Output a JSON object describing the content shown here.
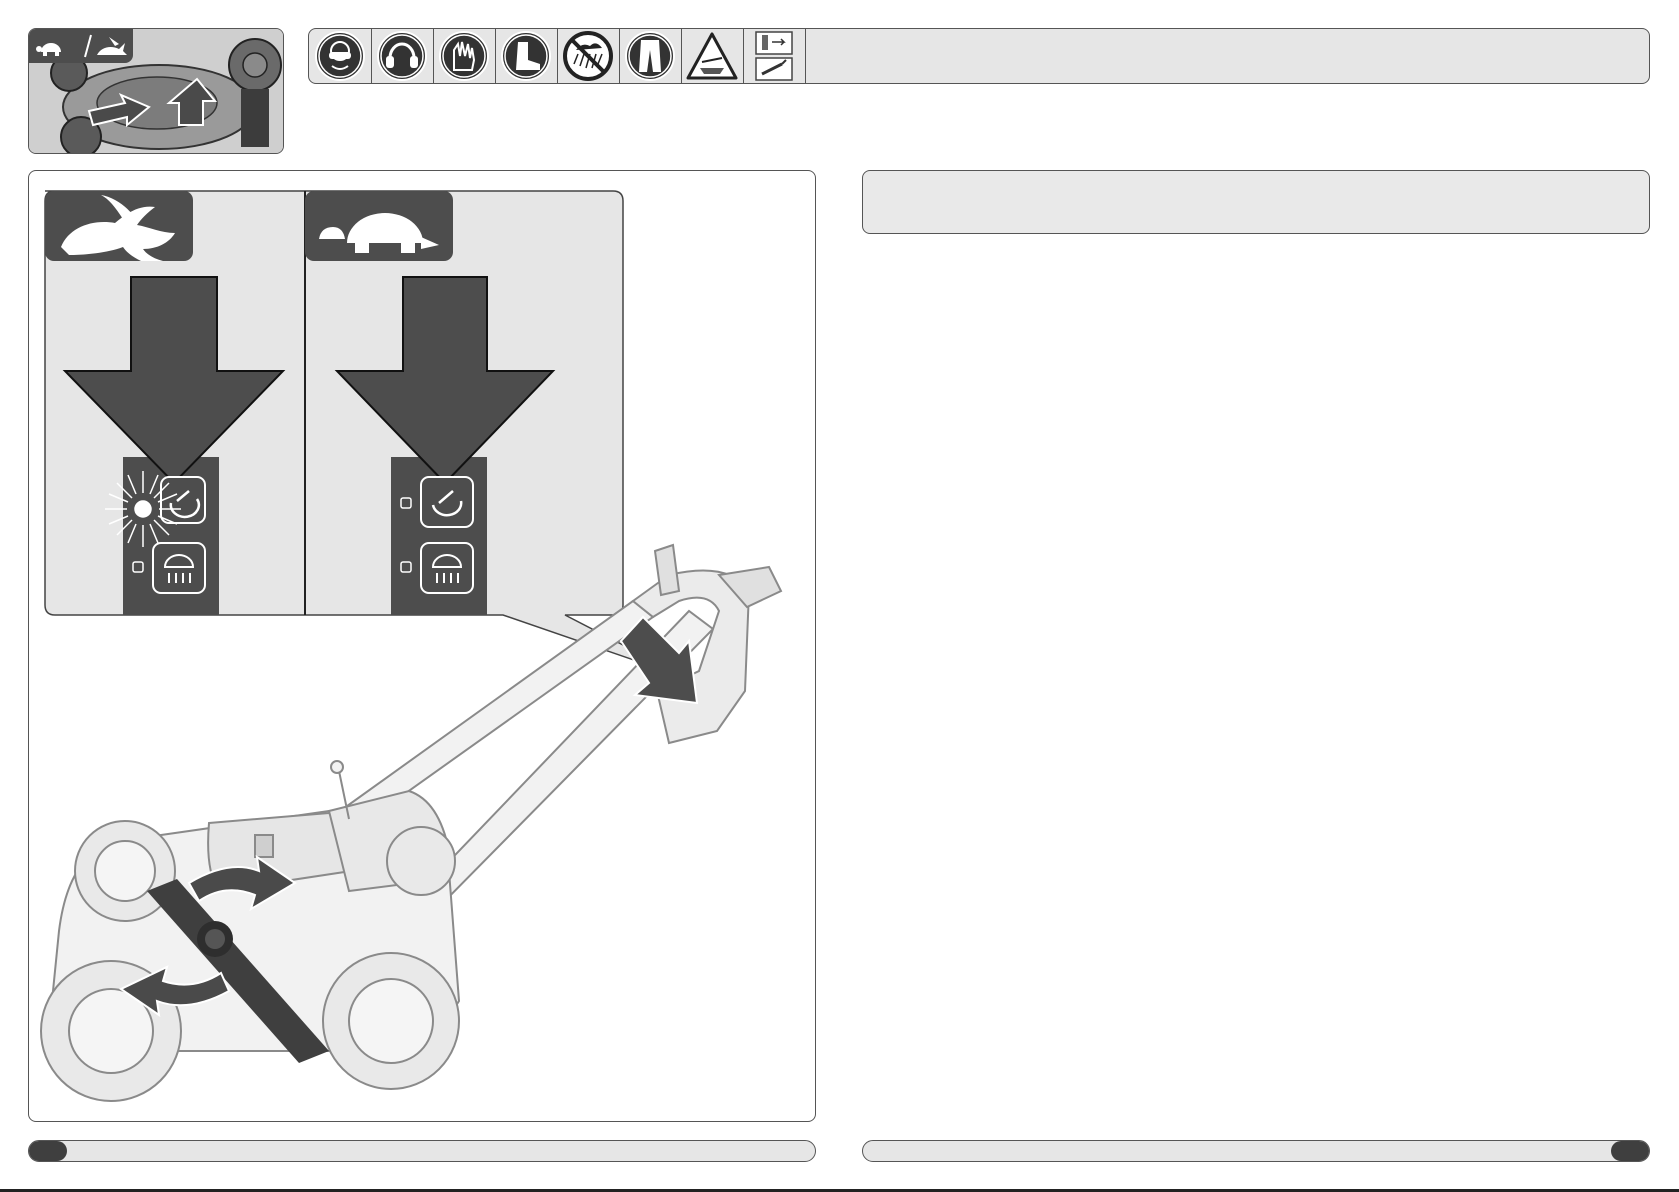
{
  "header": {
    "thumbnail": {
      "tag_icons": [
        "turtle-icon",
        "rabbit-icon"
      ],
      "separator": "/"
    },
    "safety_icons": [
      "safety-glasses-icon",
      "ear-protection-icon",
      "gloves-icon",
      "safety-boots-icon",
      "no-rain-icon",
      "long-trousers-icon",
      "warning-blade-icon",
      "remove-battery-icon"
    ]
  },
  "figure": {
    "modes": [
      {
        "id": "fast",
        "icon": "rabbit-icon",
        "indicator": "lit"
      },
      {
        "id": "slow",
        "icon": "turtle-icon",
        "indicator": "off"
      }
    ],
    "buttons": [
      "speed-button-icon",
      "sensor-button-icon"
    ]
  },
  "footer": {
    "left_page": "",
    "right_page": ""
  },
  "colors": {
    "dark": "#4d4d4d",
    "panel": "#e6e6e6",
    "border": "#555555"
  }
}
